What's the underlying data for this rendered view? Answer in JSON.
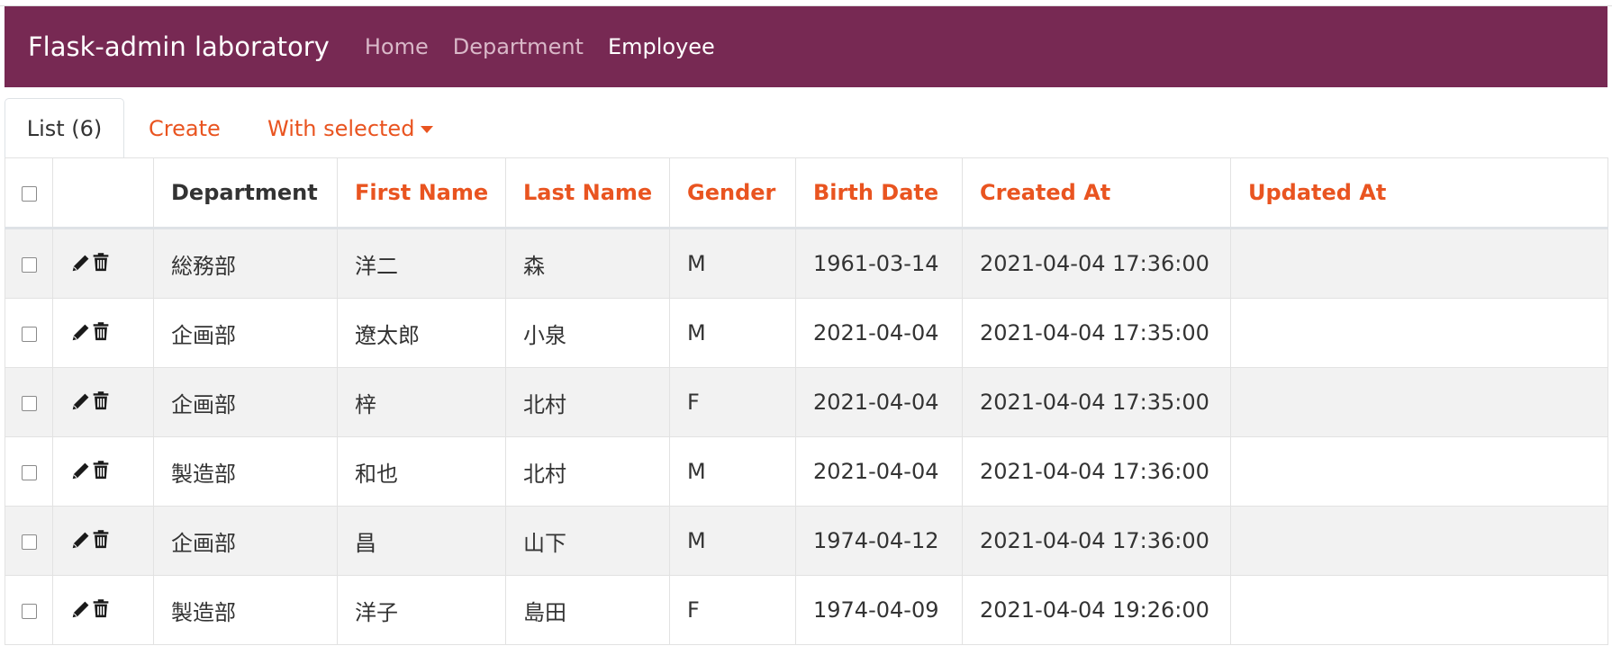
{
  "navbar": {
    "brand": "Flask-admin laboratory",
    "links": [
      {
        "label": "Home",
        "active": false
      },
      {
        "label": "Department",
        "active": false
      },
      {
        "label": "Employee",
        "active": true
      }
    ],
    "bg_color": "#772953"
  },
  "tabs": {
    "list": "List (6)",
    "create": "Create",
    "with_selected": "With selected"
  },
  "table": {
    "columns": [
      "Department",
      "First Name",
      "Last Name",
      "Gender",
      "Birth Date",
      "Created At",
      "Updated At"
    ],
    "rows": [
      {
        "department": "総務部",
        "first_name": "洋二",
        "last_name": "森",
        "gender": "M",
        "birth_date": "1961-03-14",
        "created_at": "2021-04-04 17:36:00",
        "updated_at": ""
      },
      {
        "department": "企画部",
        "first_name": "遼太郎",
        "last_name": "小泉",
        "gender": "M",
        "birth_date": "2021-04-04",
        "created_at": "2021-04-04 17:35:00",
        "updated_at": ""
      },
      {
        "department": "企画部",
        "first_name": "梓",
        "last_name": "北村",
        "gender": "F",
        "birth_date": "2021-04-04",
        "created_at": "2021-04-04 17:35:00",
        "updated_at": ""
      },
      {
        "department": "製造部",
        "first_name": "和也",
        "last_name": "北村",
        "gender": "M",
        "birth_date": "2021-04-04",
        "created_at": "2021-04-04 17:36:00",
        "updated_at": ""
      },
      {
        "department": "企画部",
        "first_name": "昌",
        "last_name": "山下",
        "gender": "M",
        "birth_date": "1974-04-12",
        "created_at": "2021-04-04 17:36:00",
        "updated_at": ""
      },
      {
        "department": "製造部",
        "first_name": "洋子",
        "last_name": "島田",
        "gender": "F",
        "birth_date": "1974-04-09",
        "created_at": "2021-04-04 19:26:00",
        "updated_at": ""
      }
    ]
  },
  "icons": {
    "edit": "pencil-icon",
    "delete": "trash-icon"
  },
  "colors": {
    "accent": "#e95420",
    "stripe": "#f2f2f2"
  }
}
